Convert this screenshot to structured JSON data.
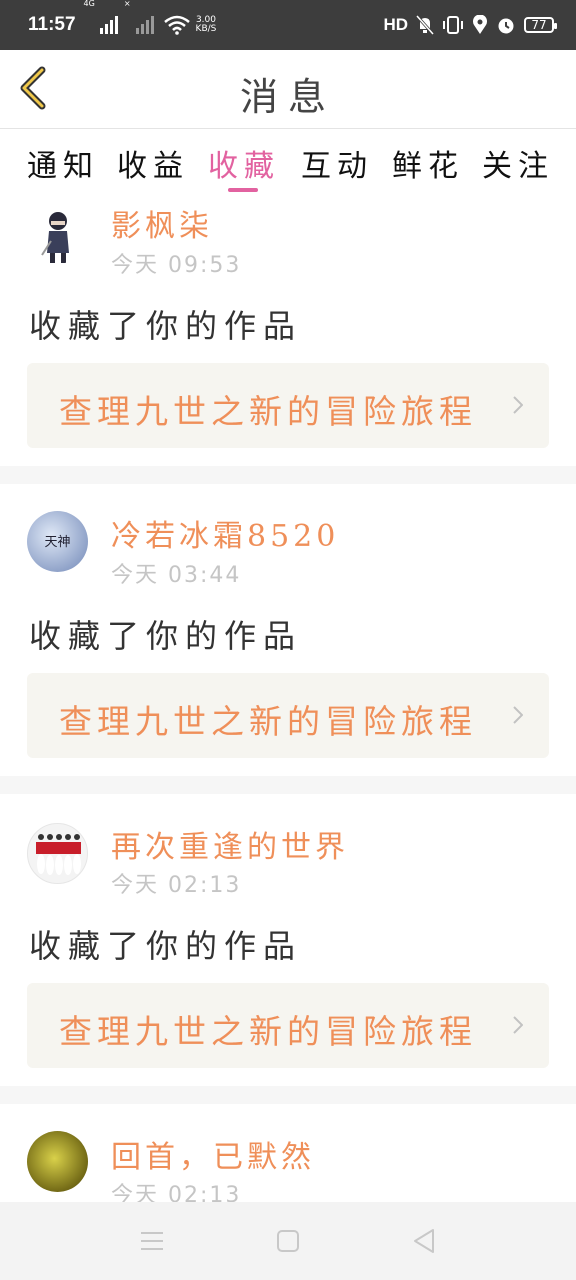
{
  "status_bar": {
    "time": "11:57",
    "network_tag_1": "4G",
    "network_tag_2": "×",
    "speed_value": "3.00",
    "speed_unit": "KB/S",
    "hd_label": "HD",
    "battery": "77"
  },
  "header": {
    "title": "消息",
    "back_icon": "chevron-left-icon"
  },
  "tabs": [
    {
      "label": "通知",
      "active": false
    },
    {
      "label": "收益",
      "active": false
    },
    {
      "label": "收藏",
      "active": true
    },
    {
      "label": "互动",
      "active": false
    },
    {
      "label": "鲜花",
      "active": false
    },
    {
      "label": "关注",
      "active": false
    }
  ],
  "colors": {
    "accent": "#e262a0",
    "username": "#ef8f59",
    "timestamp": "#c5c5c5",
    "card_bg": "#f6f5f0"
  },
  "feed": [
    {
      "username": "影枫柒",
      "time": "今天 09:53",
      "action": "收藏了你的作品",
      "work_title": "查理九世之新的冒险旅程",
      "avatar_text": ""
    },
    {
      "username": "冷若冰霜8520",
      "time": "今天 03:44",
      "action": "收藏了你的作品",
      "work_title": "查理九世之新的冒险旅程",
      "avatar_text": "天神"
    },
    {
      "username": "再次重逢的世界",
      "time": "今天 02:13",
      "action": "收藏了你的作品",
      "work_title": "查理九世之新的冒险旅程",
      "avatar_text": ""
    },
    {
      "username": "回首，已默然",
      "time": "今天 02:13",
      "action": "",
      "work_title": "",
      "avatar_text": ""
    }
  ],
  "nav": {
    "menu_icon": "menu-icon",
    "home_icon": "home-square-icon",
    "back_icon": "back-triangle-icon"
  }
}
